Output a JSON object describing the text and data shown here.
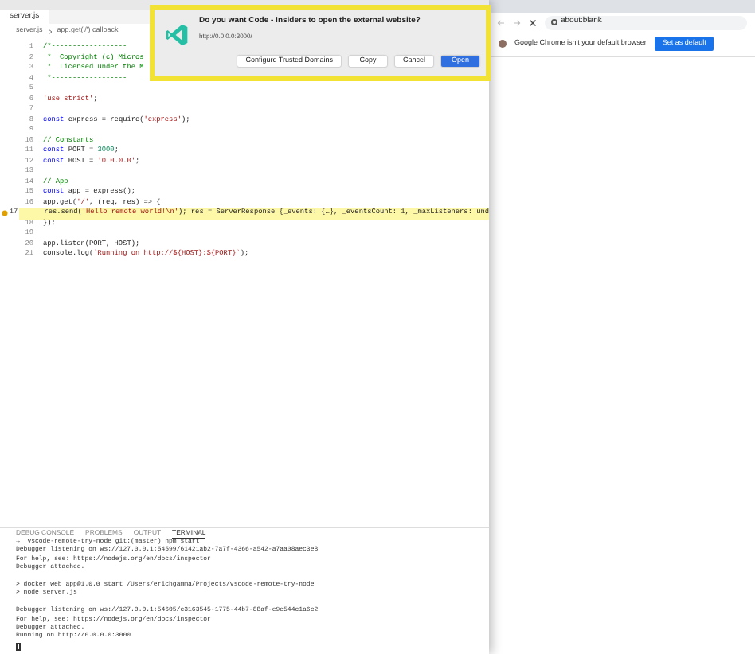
{
  "editor": {
    "tab": {
      "label": "server.js",
      "selected": true
    },
    "breadcrumb": [
      "server.js",
      "app.get('/') callback"
    ],
    "lines": [
      {
        "number": "1",
        "current": false,
        "segments": [
          {
            "kind": "comment",
            "text": "/*------------------"
          }
        ]
      },
      {
        "number": "2",
        "current": false,
        "segments": [
          {
            "kind": "comment",
            "text": " *  Copyright (c) Micros"
          }
        ]
      },
      {
        "number": "3",
        "current": false,
        "segments": [
          {
            "kind": "comment",
            "text": " *  Licensed under the M"
          }
        ]
      },
      {
        "number": "4",
        "current": false,
        "segments": [
          {
            "kind": "comment",
            "text": " *------------------"
          }
        ]
      },
      {
        "number": "5",
        "current": false
      },
      {
        "number": "6",
        "current": false,
        "segments": [
          {
            "kind": "string",
            "text": "'use strict'"
          },
          {
            "kind": "plain",
            "text": ";"
          }
        ]
      },
      {
        "number": "7",
        "current": false
      },
      {
        "number": "8",
        "current": false,
        "segments": [
          {
            "kind": "keyword",
            "text": "const"
          },
          {
            "kind": "plain",
            "text": " express = require("
          },
          {
            "kind": "string",
            "text": "'express'"
          },
          {
            "kind": "plain",
            "text": ");"
          }
        ]
      },
      {
        "number": "9",
        "current": false
      },
      {
        "number": "10",
        "current": false,
        "segments": [
          {
            "kind": "comment",
            "text": "// Constants"
          }
        ]
      },
      {
        "number": "11",
        "current": false,
        "segments": [
          {
            "kind": "keyword",
            "text": "const"
          },
          {
            "kind": "plain",
            "text": " PORT = "
          },
          {
            "kind": "number",
            "text": "3000"
          },
          {
            "kind": "plain",
            "text": ";"
          }
        ]
      },
      {
        "number": "12",
        "current": false,
        "segments": [
          {
            "kind": "keyword",
            "text": "const"
          },
          {
            "kind": "plain",
            "text": " HOST = "
          },
          {
            "kind": "string",
            "text": "'0.0.0.0'"
          },
          {
            "kind": "plain",
            "text": ";"
          }
        ]
      },
      {
        "number": "13",
        "current": false
      },
      {
        "number": "14",
        "current": false,
        "segments": [
          {
            "kind": "comment",
            "text": "// App"
          }
        ]
      },
      {
        "number": "15",
        "current": false,
        "segments": [
          {
            "kind": "keyword",
            "text": "const"
          },
          {
            "kind": "plain",
            "text": " app = express();"
          }
        ]
      },
      {
        "number": "16",
        "current": false,
        "segments": [
          {
            "kind": "plain",
            "text": "app.get("
          },
          {
            "kind": "string",
            "text": "'/'"
          },
          {
            "kind": "plain",
            "text": ", (req, res) => {"
          }
        ]
      },
      {
        "number": "17",
        "current": true,
        "segments": [
          {
            "kind": "plain",
            "text": "    res.send("
          },
          {
            "kind": "string",
            "text": "'Hello remote world!\\n'"
          },
          {
            "kind": "plain",
            "text": "); res = ServerResponse {_events: {…}, _eventsCount: 1, _maxListeners: und"
          }
        ]
      },
      {
        "number": "18",
        "current": false,
        "segments": [
          {
            "kind": "plain",
            "text": "});"
          }
        ]
      },
      {
        "number": "19",
        "current": false
      },
      {
        "number": "20",
        "current": false,
        "segments": [
          {
            "kind": "plain",
            "text": "app.listen(PORT, HOST);"
          }
        ]
      },
      {
        "number": "21",
        "current": false,
        "segments": [
          {
            "kind": "plain",
            "text": "console.log("
          },
          {
            "kind": "string",
            "text": "`Running on http://${HOST}:${PORT}`"
          },
          {
            "kind": "plain",
            "text": ");"
          }
        ]
      }
    ]
  },
  "panel": {
    "tabs": [
      {
        "label": "DEBUG CONSOLE",
        "selected": false
      },
      {
        "label": "PROBLEMS",
        "selected": false
      },
      {
        "label": "OUTPUT",
        "selected": false
      },
      {
        "label": "TERMINAL",
        "selected": true
      }
    ],
    "terminal": [
      {
        "kind": "text",
        "text": "→  vscode-remote-try-node git:(master) npm start"
      },
      {
        "kind": "text",
        "text": "Debugger listening on ws://127.0.0.1:54599/61421ab2-7a7f-4366-a542-a7aa08aec3e8"
      },
      {
        "kind": "text",
        "text": "For help, see: https://nodejs.org/en/docs/inspector"
      },
      {
        "kind": "text",
        "text": "Debugger attached."
      },
      {
        "kind": "blank"
      },
      {
        "kind": "text",
        "text": "> docker_web_app@1.0.0 start /Users/erichgamma/Projects/vscode-remote-try-node"
      },
      {
        "kind": "text",
        "text": "> node server.js"
      },
      {
        "kind": "blank"
      },
      {
        "kind": "text",
        "text": "Debugger listening on ws://127.0.0.1:54605/c3163545-1775-44b7-88af-e9e544c1a6c2"
      },
      {
        "kind": "text",
        "text": "For help, see: https://nodejs.org/en/docs/inspector"
      },
      {
        "kind": "text",
        "text": "Debugger attached."
      },
      {
        "kind": "text",
        "text": "Running on http://0.0.0.0:3000"
      }
    ]
  },
  "dialog": {
    "title": "Do you want Code - Insiders to open the external website?",
    "url": "http://0.0.0.0:3000/",
    "buttons": [
      {
        "label": "Configure Trusted Domains",
        "default": false
      },
      {
        "label": "Copy",
        "default": false
      },
      {
        "label": "Cancel",
        "default": false
      },
      {
        "label": "Open",
        "default": true
      }
    ]
  },
  "browser": {
    "address": "about:blank",
    "infobar": {
      "message": "Google Chrome isn't your default browser",
      "button": "Set as default"
    }
  }
}
